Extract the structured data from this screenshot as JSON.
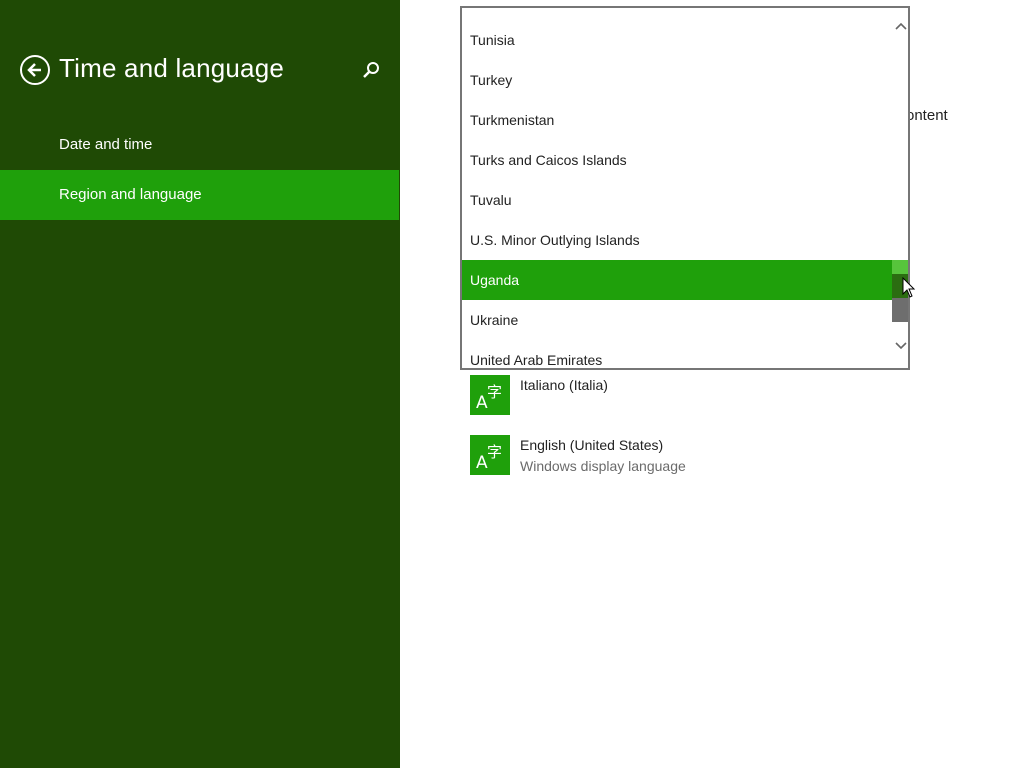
{
  "header": {
    "title": "Time and language"
  },
  "nav": {
    "items": [
      {
        "label": "Date and time",
        "selected": false
      },
      {
        "label": "Region and language",
        "selected": true
      }
    ]
  },
  "content": {
    "partial_text": "ontent",
    "languages": [
      {
        "name": "Italiano (Italia)",
        "subtitle": ""
      },
      {
        "name": "English (United States)",
        "subtitle": "Windows display language"
      }
    ]
  },
  "dropdown": {
    "options": [
      "Tunisia",
      "Turkey",
      "Turkmenistan",
      "Turks and Caicos Islands",
      "Tuvalu",
      "U.S. Minor Outlying Islands",
      "Uganda",
      "Ukraine",
      "United Arab Emirates"
    ],
    "selected": "Uganda"
  },
  "colors": {
    "sidebar_bg": "#1f4a05",
    "accent": "#1fa00b",
    "scroll_highlight": "#57c43c"
  },
  "icons": {
    "back": "back-arrow-circle-icon",
    "search": "search-icon",
    "language_tile": "language-tile-icon"
  }
}
